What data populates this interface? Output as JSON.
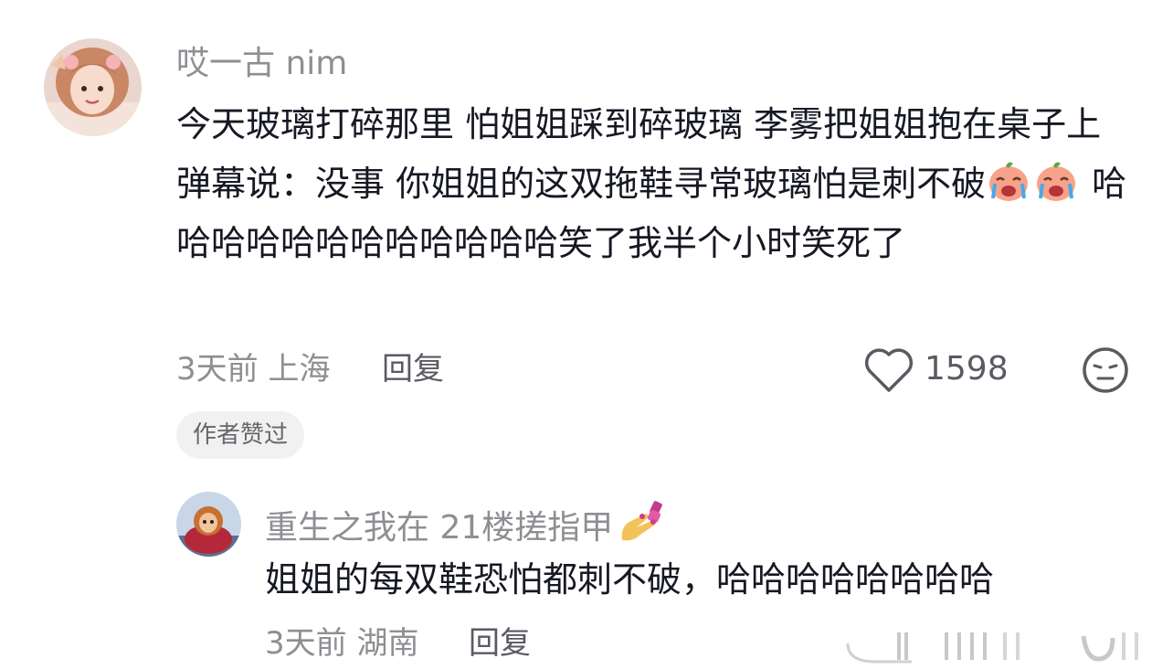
{
  "comments": [
    {
      "username": "哎一古 nim",
      "text_parts": {
        "line_main": "今天玻璃打碎那里 怕姐姐踩到碎玻璃 李雾把姐姐抱在桌子上 弹幕说：没事 你姐姐的这双拖鞋寻常玻璃怕是刺不破",
        "after_emoji": " 哈哈哈哈哈哈哈哈哈哈哈哈笑了我半个小时笑死了"
      },
      "emoji": [
        "crying-laughing-peach-emoji",
        "crying-laughing-peach-emoji"
      ],
      "time": "3天前",
      "location": "上海",
      "reply_label": "回复",
      "like_count": "1598",
      "author_badge": "作者赞过"
    },
    {
      "username": "重生之我在 21楼搓指甲",
      "username_emoji": "nail-polish-emoji",
      "text": "姐姐的每双鞋恐怕都刺不破，哈哈哈哈哈哈哈哈",
      "time": "3天前",
      "location": "湖南",
      "reply_label": "回复"
    }
  ],
  "icons": {
    "like": "heart-outline-icon",
    "dislike": "neutral-face-icon"
  },
  "colors": {
    "text": "#161823",
    "secondary": "#8e8e93",
    "badge_bg": "#f1f1f2"
  }
}
